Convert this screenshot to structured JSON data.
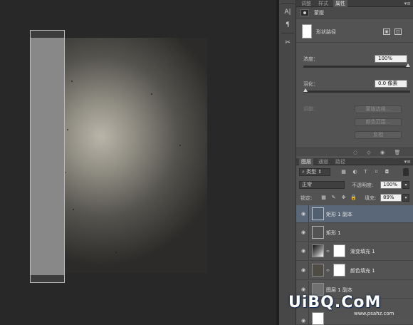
{
  "tool_strip": {
    "icons": [
      "char-icon",
      "paragraph-icon",
      "tools-icon"
    ]
  },
  "properties_panel": {
    "tabs": [
      "调整",
      "样式",
      "属性"
    ],
    "active_tab": "属性",
    "header_label": "蒙版",
    "shape_path_label": "形状路径",
    "density_label": "浓度：",
    "density_value": "100%",
    "density_fraction": 1.0,
    "feather_label": "羽化：",
    "feather_value": "0.0 像素",
    "feather_fraction": 0.0,
    "refine_label": "调整：",
    "buttons": [
      "蒙版边缘...",
      "颜色范围...",
      "反相"
    ]
  },
  "layers_panel": {
    "tabs": [
      "图层",
      "通道",
      "路径"
    ],
    "active_tab": "图层",
    "kind_filter": "类型",
    "blend_mode": "正常",
    "opacity_label": "不透明度:",
    "opacity_value": "100%",
    "lock_label": "锁定:",
    "fill_label": "填充:",
    "fill_value": "89%",
    "layers": [
      {
        "name": "矩形 1 副本",
        "selected": true
      },
      {
        "name": "矩形 1",
        "selected": false
      },
      {
        "name": "渐变填充 1",
        "selected": false
      },
      {
        "name": "颜色填充 1",
        "selected": false
      },
      {
        "name": "图层 1 副本",
        "selected": false
      }
    ]
  },
  "watermark": {
    "logo": "UiBQ.CoM",
    "url": "www.psahz.com"
  }
}
